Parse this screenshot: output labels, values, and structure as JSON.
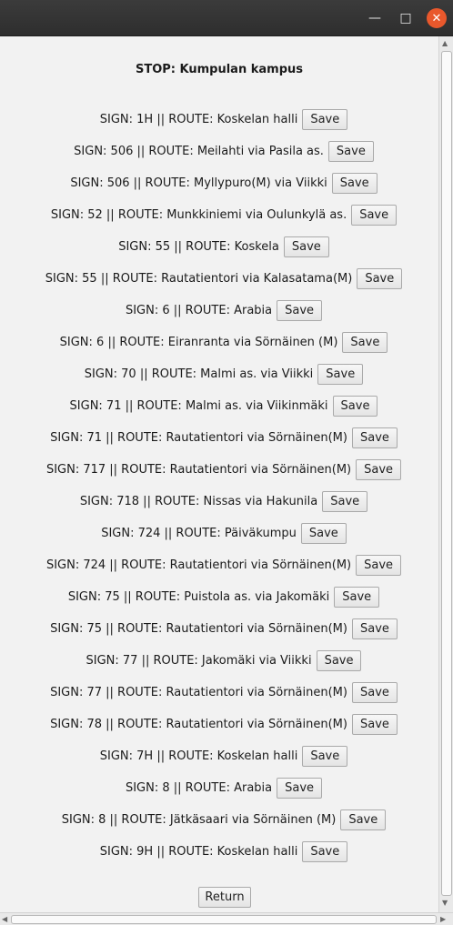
{
  "window": {
    "minimize_glyph": "—",
    "maximize_glyph": "□",
    "close_glyph": "✕",
    "close_color": "#e9582c"
  },
  "stop": {
    "title": "STOP: Kumpulan kampus"
  },
  "routes": [
    {
      "label": "SIGN: 1H || ROUTE: Koskelan halli",
      "button": "Save"
    },
    {
      "label": "SIGN: 506 || ROUTE: Meilahti via Pasila as.",
      "button": "Save"
    },
    {
      "label": "SIGN: 506 || ROUTE: Myllypuro(M) via Viikki",
      "button": "Save"
    },
    {
      "label": "SIGN: 52 || ROUTE: Munkkiniemi via Oulunkylä as.",
      "button": "Save"
    },
    {
      "label": "SIGN: 55 || ROUTE: Koskela",
      "button": "Save"
    },
    {
      "label": "SIGN: 55 || ROUTE: Rautatientori via Kalasatama(M)",
      "button": "Save"
    },
    {
      "label": "SIGN: 6 || ROUTE: Arabia",
      "button": "Save"
    },
    {
      "label": "SIGN: 6 || ROUTE: Eiranranta via Sörnäinen (M)",
      "button": "Save"
    },
    {
      "label": "SIGN: 70 || ROUTE: Malmi as. via Viikki",
      "button": "Save"
    },
    {
      "label": "SIGN: 71 || ROUTE: Malmi as. via Viikinmäki",
      "button": "Save"
    },
    {
      "label": "SIGN: 71 || ROUTE: Rautatientori via Sörnäinen(M)",
      "button": "Save"
    },
    {
      "label": "SIGN: 717 || ROUTE: Rautatientori via Sörnäinen(M)",
      "button": "Save"
    },
    {
      "label": "SIGN: 718 || ROUTE: Nissas via Hakunila",
      "button": "Save"
    },
    {
      "label": "SIGN: 724 || ROUTE: Päiväkumpu",
      "button": "Save"
    },
    {
      "label": "SIGN: 724 || ROUTE: Rautatientori via Sörnäinen(M)",
      "button": "Save"
    },
    {
      "label": "SIGN: 75 || ROUTE: Puistola as. via Jakomäki",
      "button": "Save"
    },
    {
      "label": "SIGN: 75 || ROUTE: Rautatientori via Sörnäinen(M)",
      "button": "Save"
    },
    {
      "label": "SIGN: 77 || ROUTE: Jakomäki via Viikki",
      "button": "Save"
    },
    {
      "label": "SIGN: 77 || ROUTE: Rautatientori via Sörnäinen(M)",
      "button": "Save"
    },
    {
      "label": "SIGN: 78 || ROUTE: Rautatientori via Sörnäinen(M)",
      "button": "Save"
    },
    {
      "label": "SIGN: 7H || ROUTE: Koskelan halli",
      "button": "Save"
    },
    {
      "label": "SIGN: 8 || ROUTE: Arabia",
      "button": "Save"
    },
    {
      "label": "SIGN: 8 || ROUTE: Jätkäsaari via Sörnäinen (M)",
      "button": "Save"
    },
    {
      "label": "SIGN: 9H || ROUTE: Koskelan halli",
      "button": "Save"
    }
  ],
  "footer": {
    "return_label": "Return"
  },
  "scrollbars": {
    "up_glyph": "▲",
    "down_glyph": "▼",
    "left_glyph": "◀",
    "right_glyph": "▶"
  }
}
